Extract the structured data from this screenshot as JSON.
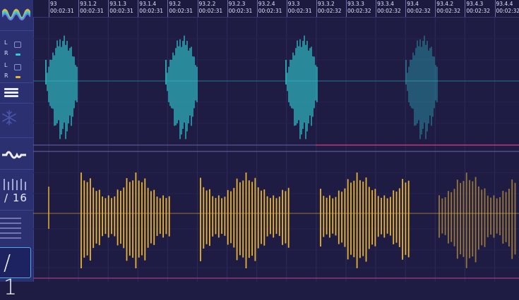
{
  "timeline": {
    "ticks": [
      {
        "pos": "93",
        "time": "00:02:31"
      },
      {
        "pos": "93.1.2",
        "time": "00:02:31"
      },
      {
        "pos": "93.1.3",
        "time": "00:02:31"
      },
      {
        "pos": "93.1.4",
        "time": "00:02:31"
      },
      {
        "pos": "93.2",
        "time": "00:02:31"
      },
      {
        "pos": "93.2.2",
        "time": "00:02:31"
      },
      {
        "pos": "93.2.3",
        "time": "00:02:31"
      },
      {
        "pos": "93.2.4",
        "time": "00:02:31"
      },
      {
        "pos": "93.3",
        "time": "00:02:31"
      },
      {
        "pos": "93.3.2",
        "time": "00:02:32"
      },
      {
        "pos": "93.3.3",
        "time": "00:02:32"
      },
      {
        "pos": "93.3.4",
        "time": "00:02:32"
      },
      {
        "pos": "93.4",
        "time": "00:02:32"
      },
      {
        "pos": "93.4.2",
        "time": "00:02:32"
      },
      {
        "pos": "93.4.3",
        "time": "00:02:32"
      },
      {
        "pos": "93.4.4",
        "time": "00:02:32"
      }
    ]
  },
  "sidebar": {
    "channels": [
      {
        "label": "L",
        "color": "#5c67c9"
      },
      {
        "label": "R",
        "color": "#35c9d8"
      },
      {
        "label": "L",
        "color": "#5c67c9"
      },
      {
        "label": "R",
        "color": "#e5b73a"
      }
    ],
    "icons": [
      "waveform-logo-icon",
      "menu-icon",
      "snowflake-icon",
      "wave-icon",
      "steps-icon",
      "lines-icon"
    ],
    "steps_label": "/ 16",
    "ratio_label": "/ 1"
  },
  "colors": {
    "teal": "#2fc3c9",
    "gold": "#e8b330",
    "background": "#1f1c44",
    "sidebar": "#2a3070",
    "marker": "#c0357a"
  }
}
